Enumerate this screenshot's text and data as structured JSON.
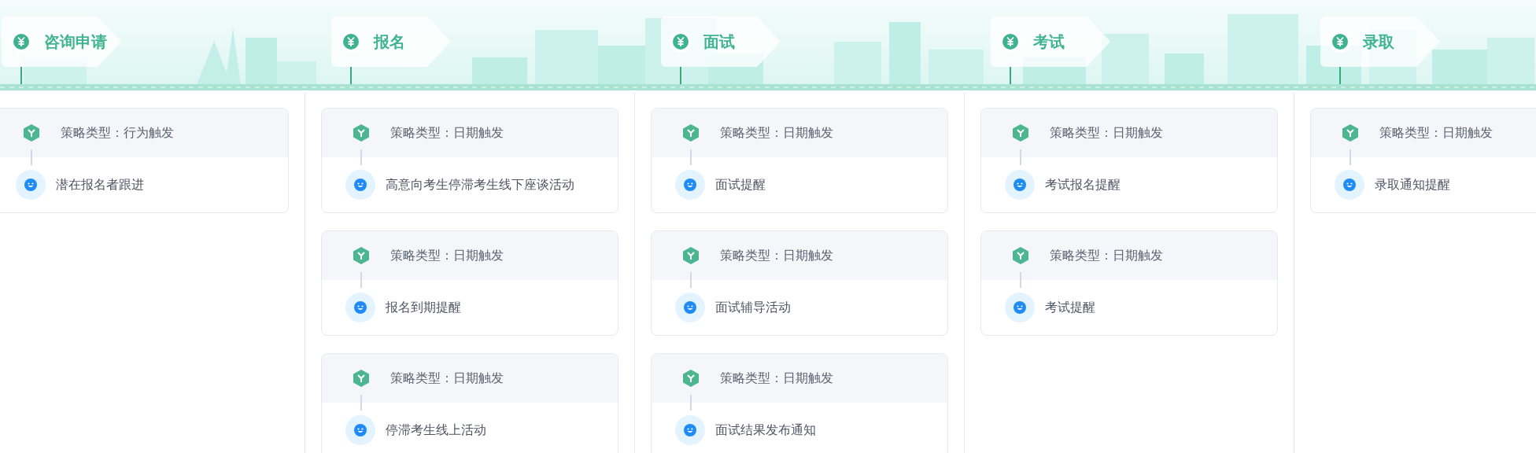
{
  "stages": [
    {
      "title": "咨询申请",
      "strategies": [
        {
          "type": "策略类型：行为触发",
          "action": "潜在报名者跟进"
        }
      ]
    },
    {
      "title": "报名",
      "strategies": [
        {
          "type": "策略类型：日期触发",
          "action": "高意向考生停滞考生线下座谈活动"
        },
        {
          "type": "策略类型：日期触发",
          "action": "报名到期提醒"
        },
        {
          "type": "策略类型：日期触发",
          "action": "停滞考生线上活动"
        }
      ]
    },
    {
      "title": "面试",
      "strategies": [
        {
          "type": "策略类型：日期触发",
          "action": "面试提醒"
        },
        {
          "type": "策略类型：日期触发",
          "action": "面试辅导活动"
        },
        {
          "type": "策略类型：日期触发",
          "action": "面试结果发布通知"
        }
      ]
    },
    {
      "title": "考试",
      "strategies": [
        {
          "type": "策略类型：日期触发",
          "action": "考试报名提醒"
        },
        {
          "type": "策略类型：日期触发",
          "action": "考试提醒"
        }
      ]
    },
    {
      "title": "录取",
      "strategies": [
        {
          "type": "策略类型：日期触发",
          "action": "录取通知提醒"
        }
      ]
    }
  ]
}
